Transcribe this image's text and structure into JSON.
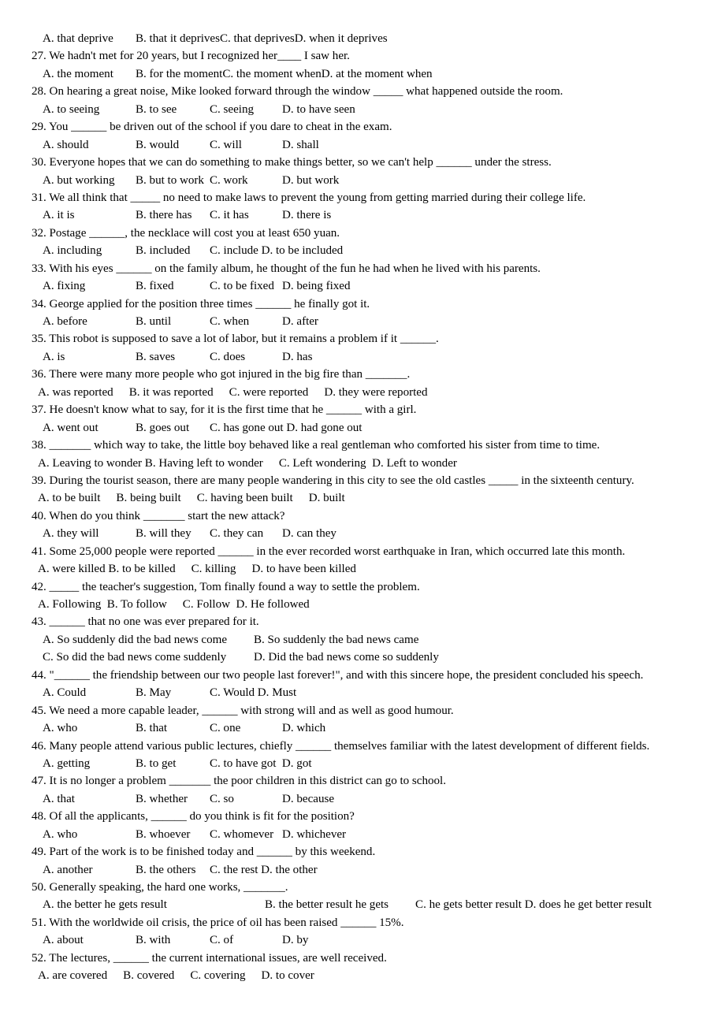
{
  "document": {
    "kind": "english-grammar-multiple-choice-worksheet",
    "page_background": "#ffffff",
    "text_color": "#000000"
  },
  "lines": [
    {
      "id": "q26-options",
      "type": "options",
      "layout": "tabbed",
      "items": [
        "A. that deprive",
        "B. that it deprives",
        "C. that deprives",
        "D. when it deprives"
      ]
    },
    {
      "id": "q27-stem",
      "type": "stem",
      "text": "27. We hadn't met for 20 years, but I recognized her____ I saw her."
    },
    {
      "id": "q27-options",
      "type": "options",
      "layout": "tabbed",
      "items": [
        "A. the moment",
        "B. for the moment",
        "C. the moment when",
        "D. at the moment when"
      ]
    },
    {
      "id": "q28-stem",
      "type": "stem",
      "text": "28. On hearing a great noise, Mike looked forward through the window _____ what happened outside the room."
    },
    {
      "id": "q28-options",
      "type": "options",
      "layout": "tabbed",
      "items": [
        "A. to seeing",
        "B. to see",
        "C. seeing",
        "D. to have seen"
      ]
    },
    {
      "id": "q29-stem",
      "type": "stem",
      "text": "29. You ______ be driven out of the school if you dare to cheat in the exam."
    },
    {
      "id": "q29-options",
      "type": "options",
      "layout": "tabbed",
      "items": [
        "A. should",
        "B. would",
        "C. will",
        "D. shall"
      ]
    },
    {
      "id": "q30-stem",
      "type": "stem",
      "text": "30. Everyone hopes that we can do something to make things better, so we can't help ______ under the stress."
    },
    {
      "id": "q30-options",
      "type": "options",
      "layout": "tabbed",
      "items": [
        "A. but working",
        "B. but to work",
        "C. work",
        "D. but work"
      ]
    },
    {
      "id": "q31-stem",
      "type": "stem",
      "text": "31. We all think that _____ no need to make laws to prevent the young from getting married during their college life."
    },
    {
      "id": "q31-options",
      "type": "options",
      "layout": "tabbed",
      "items": [
        "A. it is",
        "B. there has",
        "C. it has",
        "D. there is"
      ]
    },
    {
      "id": "q32-stem",
      "type": "stem",
      "text": "32. Postage ______, the necklace will cost you at least 650 yuan."
    },
    {
      "id": "q32-options",
      "type": "options",
      "layout": "tabbed",
      "items": [
        "A. including",
        "B. included",
        "C. include D. to be included"
      ]
    },
    {
      "id": "q33-stem",
      "type": "stem",
      "text": "33. With his eyes ______ on the family album, he thought of the fun he had when he lived with his parents."
    },
    {
      "id": "q33-options",
      "type": "options",
      "layout": "tabbed",
      "items": [
        "A. fixing",
        "B. fixed",
        "C. to be fixed",
        "D. being fixed"
      ]
    },
    {
      "id": "q34-stem",
      "type": "stem",
      "text": "34. George applied for the position three times ______ he finally got it."
    },
    {
      "id": "q34-options",
      "type": "options",
      "layout": "tabbed",
      "items": [
        "A. before",
        "B. until",
        "C. when",
        "D. after"
      ]
    },
    {
      "id": "q35-stem",
      "type": "stem",
      "text": "35. This robot is supposed to save a lot of labor, but it remains a problem if it ______."
    },
    {
      "id": "q35-options",
      "type": "options",
      "layout": "tabbed",
      "items": [
        "A. is",
        "B. saves",
        "C. does",
        "D. has"
      ]
    },
    {
      "id": "q36-stem",
      "type": "stem",
      "text": "36. There were many more people who got injured in the big fire than _______."
    },
    {
      "id": "q36-options",
      "type": "options",
      "layout": "natural",
      "items": [
        "A. was reported",
        "B. it was reported",
        "C. were reported",
        "D. they were reported"
      ]
    },
    {
      "id": "q37-stem",
      "type": "stem",
      "text": "37. He doesn't know what to say, for it is the first time that he ______ with a girl."
    },
    {
      "id": "q37-options",
      "type": "options",
      "layout": "tabbed",
      "items": [
        "A. went out",
        "B. goes out",
        "C. has gone out D. had gone out"
      ]
    },
    {
      "id": "q38-stem",
      "type": "stem",
      "text": "38. _______ which way to take, the little boy behaved like a real gentleman who comforted his sister from time to time."
    },
    {
      "id": "q38-options",
      "type": "options",
      "layout": "natural",
      "items": [
        "A. Leaving to wonder B. Having left to wonder",
        "C. Left wondering  D. Left to wonder"
      ]
    },
    {
      "id": "q39-stem",
      "type": "stem",
      "text": "39. During the tourist season, there are many people wandering in this city to see the old castles _____ in the sixteenth century."
    },
    {
      "id": "q39-options",
      "type": "options",
      "layout": "natural",
      "items": [
        "A. to be built",
        "B. being built",
        "C. having been built",
        "D. built"
      ]
    },
    {
      "id": "q40-stem",
      "type": "stem",
      "text": "40. When do you think _______ start the new attack?"
    },
    {
      "id": "q40-options",
      "type": "options",
      "layout": "tabbed",
      "items": [
        "A. they will",
        "B. will they",
        "C. they can",
        "D. can they"
      ]
    },
    {
      "id": "q41-stem",
      "type": "stem",
      "text": "41. Some 25,000 people were reported ______ in the ever recorded worst earthquake in Iran, which occurred late this month."
    },
    {
      "id": "q41-options",
      "type": "options",
      "layout": "natural",
      "items": [
        "A. were killed B. to be killed",
        "C. killing",
        "D. to have been killed"
      ]
    },
    {
      "id": "q42-stem",
      "type": "stem",
      "text": "42. _____ the teacher's suggestion, Tom finally found a way to settle the problem."
    },
    {
      "id": "q42-options",
      "type": "options",
      "layout": "natural",
      "items": [
        "A. Following  B. To follow",
        "C. Follow  D. He followed"
      ]
    },
    {
      "id": "q43-stem",
      "type": "stem",
      "text": "43. ______ that no one was ever prepared for it."
    },
    {
      "id": "q43-options-row1",
      "type": "options",
      "layout": "two-column",
      "items": [
        "A. So suddenly did the bad news come",
        "B. So suddenly the bad news came"
      ]
    },
    {
      "id": "q43-options-row2",
      "type": "options",
      "layout": "two-column",
      "items": [
        "C. So did the bad news come suddenly",
        "D. Did the bad news come so suddenly"
      ]
    },
    {
      "id": "q44-stem",
      "type": "stem",
      "text": "44. \"______ the friendship between our two people last forever!\", and with this sincere hope, the president concluded his speech."
    },
    {
      "id": "q44-options",
      "type": "options",
      "layout": "tabbed",
      "items": [
        "A. Could",
        "B. May",
        "C. Would D. Must"
      ]
    },
    {
      "id": "q45-stem",
      "type": "stem",
      "text": "45. We need a more capable leader, ______ with strong will and as well as good humour."
    },
    {
      "id": "q45-options",
      "type": "options",
      "layout": "tabbed",
      "items": [
        "A. who",
        "B. that",
        "C. one",
        "D. which"
      ]
    },
    {
      "id": "q46-stem",
      "type": "stem",
      "text": "46. Many people attend various public lectures, chiefly ______ themselves familiar with the latest development of different fields."
    },
    {
      "id": "q46-options",
      "type": "options",
      "layout": "tabbed",
      "items": [
        "A. getting",
        "B. to get",
        "C. to have got  D. got"
      ]
    },
    {
      "id": "q47-stem",
      "type": "stem",
      "text": "47. It is no longer a problem _______ the poor children in this district can go to school."
    },
    {
      "id": "q47-options",
      "type": "options",
      "layout": "tabbed",
      "items": [
        "A. that",
        "B. whether",
        "C. so",
        "D. because"
      ]
    },
    {
      "id": "q48-stem",
      "type": "stem",
      "text": "48. Of all the applicants, ______ do you think is fit for the position?"
    },
    {
      "id": "q48-options",
      "type": "options",
      "layout": "tabbed",
      "items": [
        "A. who",
        "B. whoever",
        "C. whomever",
        "D. whichever"
      ]
    },
    {
      "id": "q49-stem",
      "type": "stem",
      "text": "49. Part of the work is to be finished today and ______ by this weekend."
    },
    {
      "id": "q49-options",
      "type": "options",
      "layout": "tabbed",
      "items": [
        "A. another",
        "B. the others",
        "C. the rest D. the other"
      ]
    },
    {
      "id": "q50-stem",
      "type": "stem",
      "text": "50. Generally speaking, the hard one works, _______."
    },
    {
      "id": "q50-options",
      "type": "options",
      "layout": "wide",
      "items": [
        "A. the better he gets result",
        "B. the better result he gets",
        "C. he gets better result D. does he get better result"
      ]
    },
    {
      "id": "q51-stem",
      "type": "stem",
      "text": "51. With the worldwide oil crisis, the price of oil has been raised ______ 15%."
    },
    {
      "id": "q51-options",
      "type": "options",
      "layout": "tabbed",
      "items": [
        "A. about",
        "B. with",
        "C. of",
        "D. by"
      ]
    },
    {
      "id": "q52-stem",
      "type": "stem",
      "text": "52. The lectures, ______ the current international issues, are well received."
    },
    {
      "id": "q52-options",
      "type": "options",
      "layout": "natural",
      "items": [
        "A. are covered",
        "B. covered",
        "C. covering",
        "D. to cover"
      ]
    }
  ]
}
